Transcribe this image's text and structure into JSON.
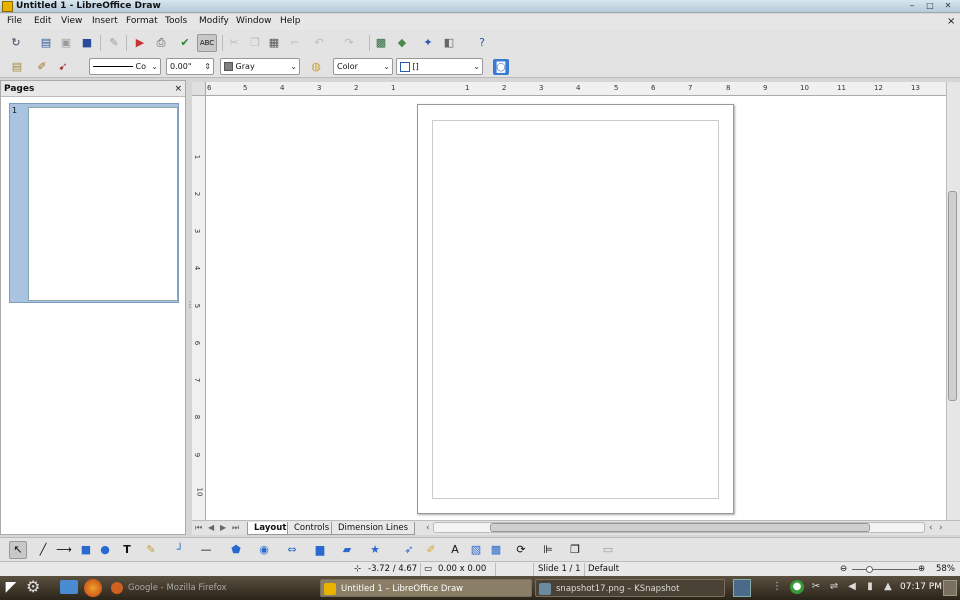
{
  "window": {
    "title": "Untitled 1 - LibreOffice Draw",
    "minimize": "‒",
    "maximize": "□",
    "close": "✕",
    "doc_close": "×"
  },
  "menu": [
    "File",
    "Edit",
    "View",
    "Insert",
    "Format",
    "Tools",
    "Modify",
    "Window",
    "Help"
  ],
  "toolbar2": {
    "line_style": "Co",
    "line_width": "0.00\"",
    "line_color": "Gray",
    "area_style": "Color",
    "area_fill": "[]"
  },
  "pages_panel": {
    "title": "Pages",
    "close": "×",
    "thumb_number": "1"
  },
  "ruler": {
    "h_labels": [
      "6",
      "5",
      "4",
      "3",
      "2",
      "1",
      "1",
      "2",
      "3",
      "4",
      "5",
      "6",
      "7",
      "8",
      "9",
      "10",
      "11",
      "12",
      "13"
    ],
    "v_labels": [
      "1",
      "2",
      "3",
      "4",
      "5",
      "6",
      "7",
      "8",
      "9",
      "10"
    ]
  },
  "tabs": [
    {
      "label": "Layout",
      "active": true
    },
    {
      "label": "Controls",
      "active": false
    },
    {
      "label": "Dimension Lines",
      "active": false
    }
  ],
  "status": {
    "position": "-3.72 / 4.67",
    "size": "0.00 x 0.00",
    "slide": "Slide 1 / 1",
    "layout": "Default",
    "zoom": "58%"
  },
  "taskbar": {
    "tasks": [
      {
        "label": "Google - Mozilla Firefox",
        "active": false
      },
      {
        "label": "Untitled 1 – LibreOffice Draw",
        "active": true
      },
      {
        "label": "snapshot17.png – KSnapshot",
        "active": false
      }
    ],
    "clock": "07:17 PM"
  },
  "colors": {
    "accent": "#a9c3e0",
    "titlebar": "#b6cad8"
  }
}
